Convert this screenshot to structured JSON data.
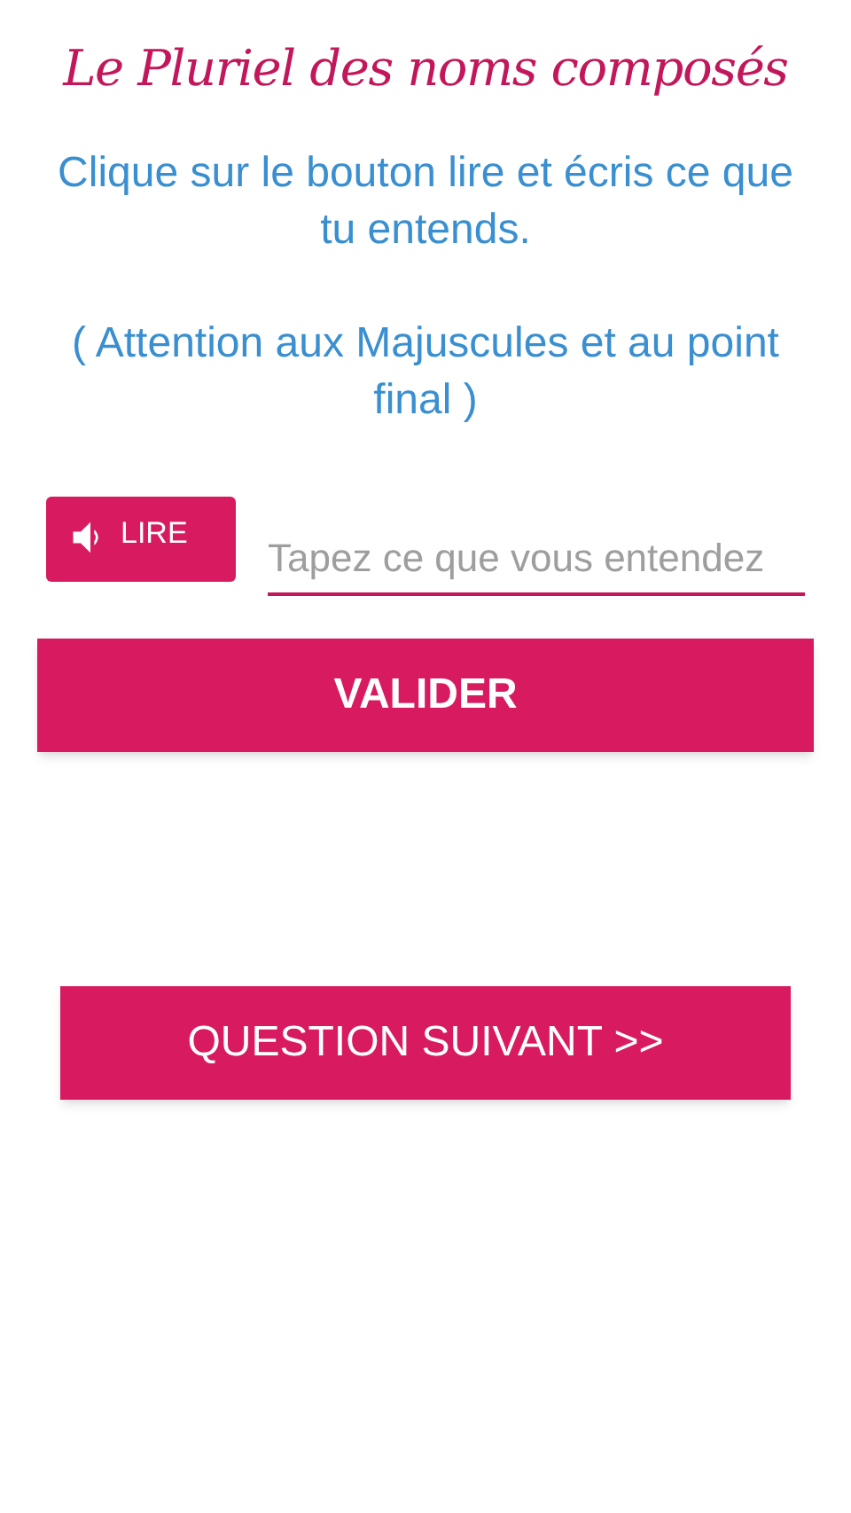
{
  "title": "Le Pluriel des noms composés",
  "instructions": [
    "Clique sur le bouton lire et écris ce que tu entends.",
    "( Attention aux Majuscules et au point final )"
  ],
  "read_button": {
    "label": "LIRE"
  },
  "answer": {
    "placeholder": "Tapez ce que vous entendez"
  },
  "validate_button": {
    "label": "VALIDER"
  },
  "next_button": {
    "label": "QUESTION SUIVANT >>"
  }
}
